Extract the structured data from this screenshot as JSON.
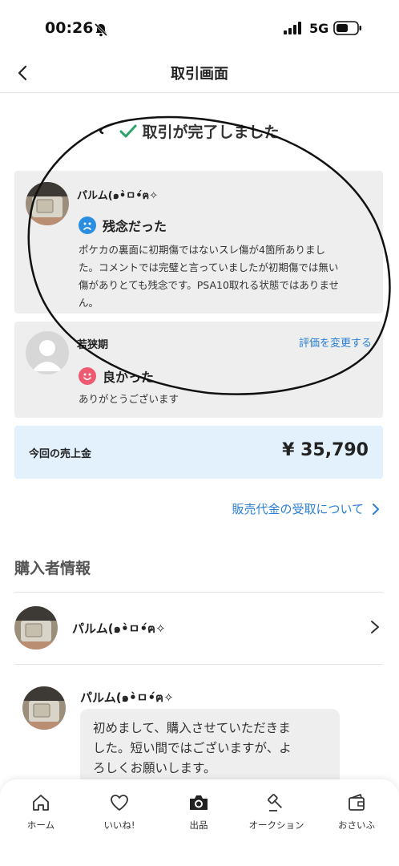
{
  "status_bar": {
    "time": "00:26",
    "network": "5G"
  },
  "nav": {
    "title": "取引画面"
  },
  "transaction": {
    "complete_text": "取引が完了しました"
  },
  "reviews": [
    {
      "name": "パルム(๑•̀ㅁ•́ฅ✧",
      "rating": "残念だった",
      "body_lines": [
        "ポケカの裏面に初期傷ではないスレ傷が4箇所ありまし",
        "た。コメントでは完璧と言っていましたが初期傷では無い",
        "傷がありとても残念です。PSA10取れる状態ではありませ",
        "ん。"
      ]
    },
    {
      "name": "若狭期",
      "rating": "良かった",
      "body": "ありがとうございます",
      "change_link": "評価を変更する"
    }
  ],
  "sales": {
    "label": "今回の売上金",
    "amount": "¥ 35,790"
  },
  "receive_link": "販売代金の受取について",
  "buyer_section": {
    "title": "購入者情報",
    "name": "パルム(๑•̀ㅁ•́ฅ✧"
  },
  "message": {
    "name": "パルム(๑•̀ㅁ•́ฅ✧",
    "lines": [
      "初めまして、購入させていただきま",
      "した。短い間ではございますが、よ",
      "ろしくお願いします。"
    ]
  },
  "tabs": [
    {
      "label": "ホーム",
      "icon": "home-icon"
    },
    {
      "label": "いいね!",
      "icon": "heart-icon"
    },
    {
      "label": "出品",
      "icon": "camera-icon"
    },
    {
      "label": "オークション",
      "icon": "gavel-icon"
    },
    {
      "label": "おさいふ",
      "icon": "wallet-icon"
    }
  ],
  "colors": {
    "accent": "#2a7fd4",
    "success": "#2aa36b",
    "sales_bg": "#e2f1fb",
    "card_bg": "#eeeeef"
  }
}
